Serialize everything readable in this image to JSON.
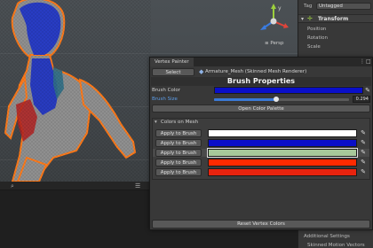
{
  "inspector": {
    "tag_label": "Tag",
    "tag_value": "Untagged",
    "component_title": "Transform",
    "fields": [
      "Position",
      "Rotation",
      "Scale"
    ],
    "footer_items": [
      "Additional Settings",
      "Skinned Motion Vectors"
    ]
  },
  "scene": {
    "persp_label": "≡ Persp",
    "axis_labels": {
      "y": "y",
      "x": "x",
      "z": "z"
    }
  },
  "vertex_painter": {
    "window_title": "Vertex Painter",
    "select_button": "Select",
    "mesh_name": "Armature_Mesh (Skinned Mesh Renderer)",
    "header": "Brush Properties",
    "brush_color_label": "Brush Color",
    "brush_color": "#0a0fc8",
    "brush_size_label": "Brush Size",
    "brush_size_value": "0.294",
    "brush_size_fraction": 0.46,
    "open_palette_button": "Open Color Palette",
    "colors_section_title": "Colors on Mesh",
    "colors": [
      {
        "button": "Apply to Brush",
        "hex": "#ffffff",
        "selected": false
      },
      {
        "button": "Apply to Brush",
        "hex": "#0a0fc8",
        "selected": false
      },
      {
        "button": "Apply to Brush",
        "hex": "#a7c89a",
        "selected": true
      },
      {
        "button": "Apply to Brush",
        "hex": "#ff2a00",
        "selected": false
      },
      {
        "button": "Apply to Brush",
        "hex": "#e8230e",
        "selected": false
      }
    ],
    "reset_button": "Reset Vertex Colors"
  },
  "colors": {
    "accent_blue": "#3a79d6",
    "selection_orange": "#ff7a1a",
    "panel_bg": "#383838"
  }
}
